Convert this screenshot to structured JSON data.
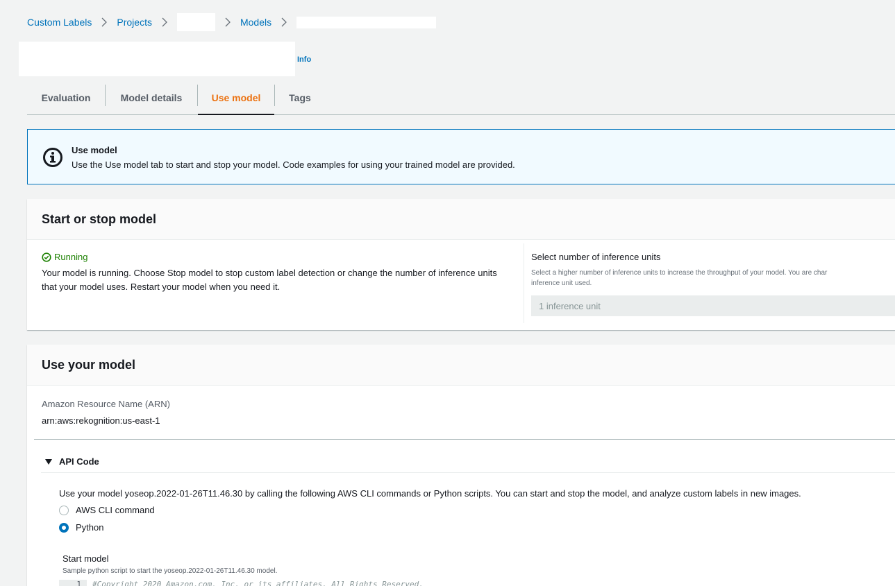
{
  "breadcrumb": {
    "items": [
      {
        "label": "Custom Labels"
      },
      {
        "label": "Projects"
      },
      {
        "label": ""
      },
      {
        "label": "Models"
      },
      {
        "label": ""
      }
    ]
  },
  "header": {
    "title": "",
    "info_label": "Info"
  },
  "tabs": [
    {
      "label": "Evaluation",
      "active": false
    },
    {
      "label": "Model details",
      "active": false
    },
    {
      "label": "Use model",
      "active": true
    },
    {
      "label": "Tags",
      "active": false
    }
  ],
  "alert": {
    "icon": "info-icon",
    "title": "Use model",
    "text": "Use the Use model tab to start and stop your model. Code examples for using your trained model are provided."
  },
  "start_stop": {
    "title": "Start or stop model",
    "status": "Running",
    "status_color": "#1d8102",
    "description": "Your model is running. Choose Stop model to stop custom label detection or change the number of inference units that your model uses. Restart your model when you need it.",
    "inference_label": "Select number of inference units",
    "inference_desc_1": "Select a higher number of inference units to increase the throughput of your model. You are char",
    "inference_desc_2": "inference unit used.",
    "inference_value": "1 inference unit"
  },
  "use_model": {
    "title": "Use your model",
    "arn_label": "Amazon Resource Name (ARN)",
    "arn_value": "arn:aws:rekognition:us-east-1",
    "api_code_label": "API Code",
    "api_desc": "Use your model yoseop.2022-01-26T11.46.30 by calling the following AWS CLI commands or Python scripts. You can start and stop the model, and analyze custom labels in new images.",
    "options": [
      {
        "label": "AWS CLI command",
        "checked": false
      },
      {
        "label": "Python",
        "checked": true
      }
    ],
    "start_title": "Start model",
    "start_desc": "Sample python script to start the yoseop.2022-01-26T11.46.30 model.",
    "code_line_no": "1",
    "code_line": "#Copyright 2020 Amazon.com, Inc. or its affiliates. All Rights Reserved."
  },
  "colors": {
    "link": "#0073bb",
    "accent": "#ec7211",
    "alert_bg": "#f1faff",
    "page_bg": "#f2f3f3"
  }
}
